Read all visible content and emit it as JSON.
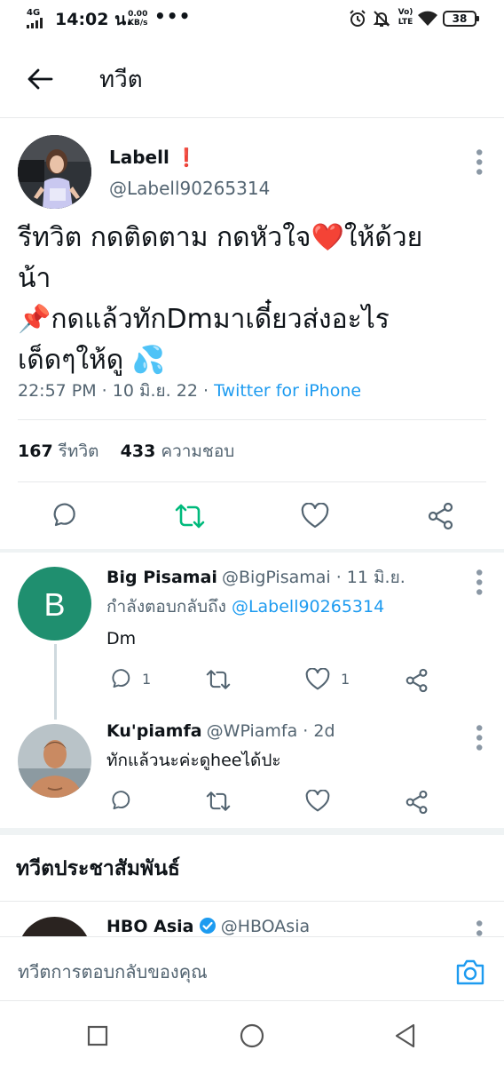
{
  "status_bar": {
    "network": "4G",
    "time": "14:02 น.",
    "speed_value": "0.00",
    "speed_unit": "KB/s",
    "dots": "•••",
    "volte": "Vo) LTE",
    "battery": "38"
  },
  "header": {
    "title": "ทวีต"
  },
  "tweet": {
    "name": "Labell",
    "handle": "@Labell90265314",
    "text_line1": "รีทวิต กดติดตาม กดหัวใจ❤️ให้ด้วย",
    "text_line2": "น้า",
    "text_line3": "📌กดแล้วทักDmมาเดี๋ยวส่งอะไร",
    "text_line4": "เด็ดๆให้ดู 💦",
    "meta_time": "22:57 PM · 10 มิ.ย. 22 · ",
    "meta_via": "Twitter for iPhone",
    "retweets_count": "167",
    "retweets_label": "รีทวิต",
    "likes_count": "433",
    "likes_label": "ความชอบ",
    "retweet_color": "#00ba7c"
  },
  "replies": [
    {
      "avatar_letter": "B",
      "avatar_color": "#1f8f6f",
      "name": "Big Pisamai",
      "handle": "@BigPisamai · 11 มิ.ย.",
      "replying_label": "กำลังตอบกลับถึง ",
      "replying_to": "@Labell90265314",
      "text": "Dm",
      "reply_count": "1",
      "like_count": "1"
    },
    {
      "name": "Ku'piamfa",
      "handle": "@WPiamfa · 2d",
      "text": "ทักแล้วนะค่ะดูheeได้ปะ"
    }
  ],
  "related": {
    "title": "ทวีตประชาสัมพันธ์",
    "name": "HBO Asia",
    "handle": "@HBOAsia"
  },
  "composer": {
    "placeholder": "ทวีตการตอบกลับของคุณ"
  },
  "colors": {
    "accent": "#1d9bf0",
    "muted": "#536471"
  }
}
